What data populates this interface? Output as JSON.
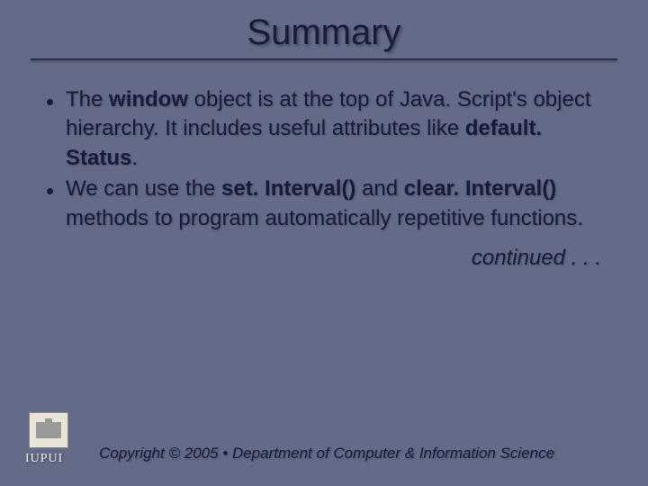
{
  "title": "Summary",
  "bullets": [
    {
      "pre1": "The ",
      "code1": "window",
      "mid1": " object is at the top of Java. Script's object hierarchy. It includes useful attributes like ",
      "code2": "default. Status",
      "post1": "."
    },
    {
      "pre1": "We can use the ",
      "code1": "set. Interval()",
      "mid1": " and ",
      "code2": "clear. Interval()",
      "post1": " methods to program automatically repetitive functions."
    }
  ],
  "continued": "continued . . .",
  "footer": {
    "org": "IUPUI",
    "copyright": "Copyright © 2005 • Department of Computer & Information Science"
  }
}
